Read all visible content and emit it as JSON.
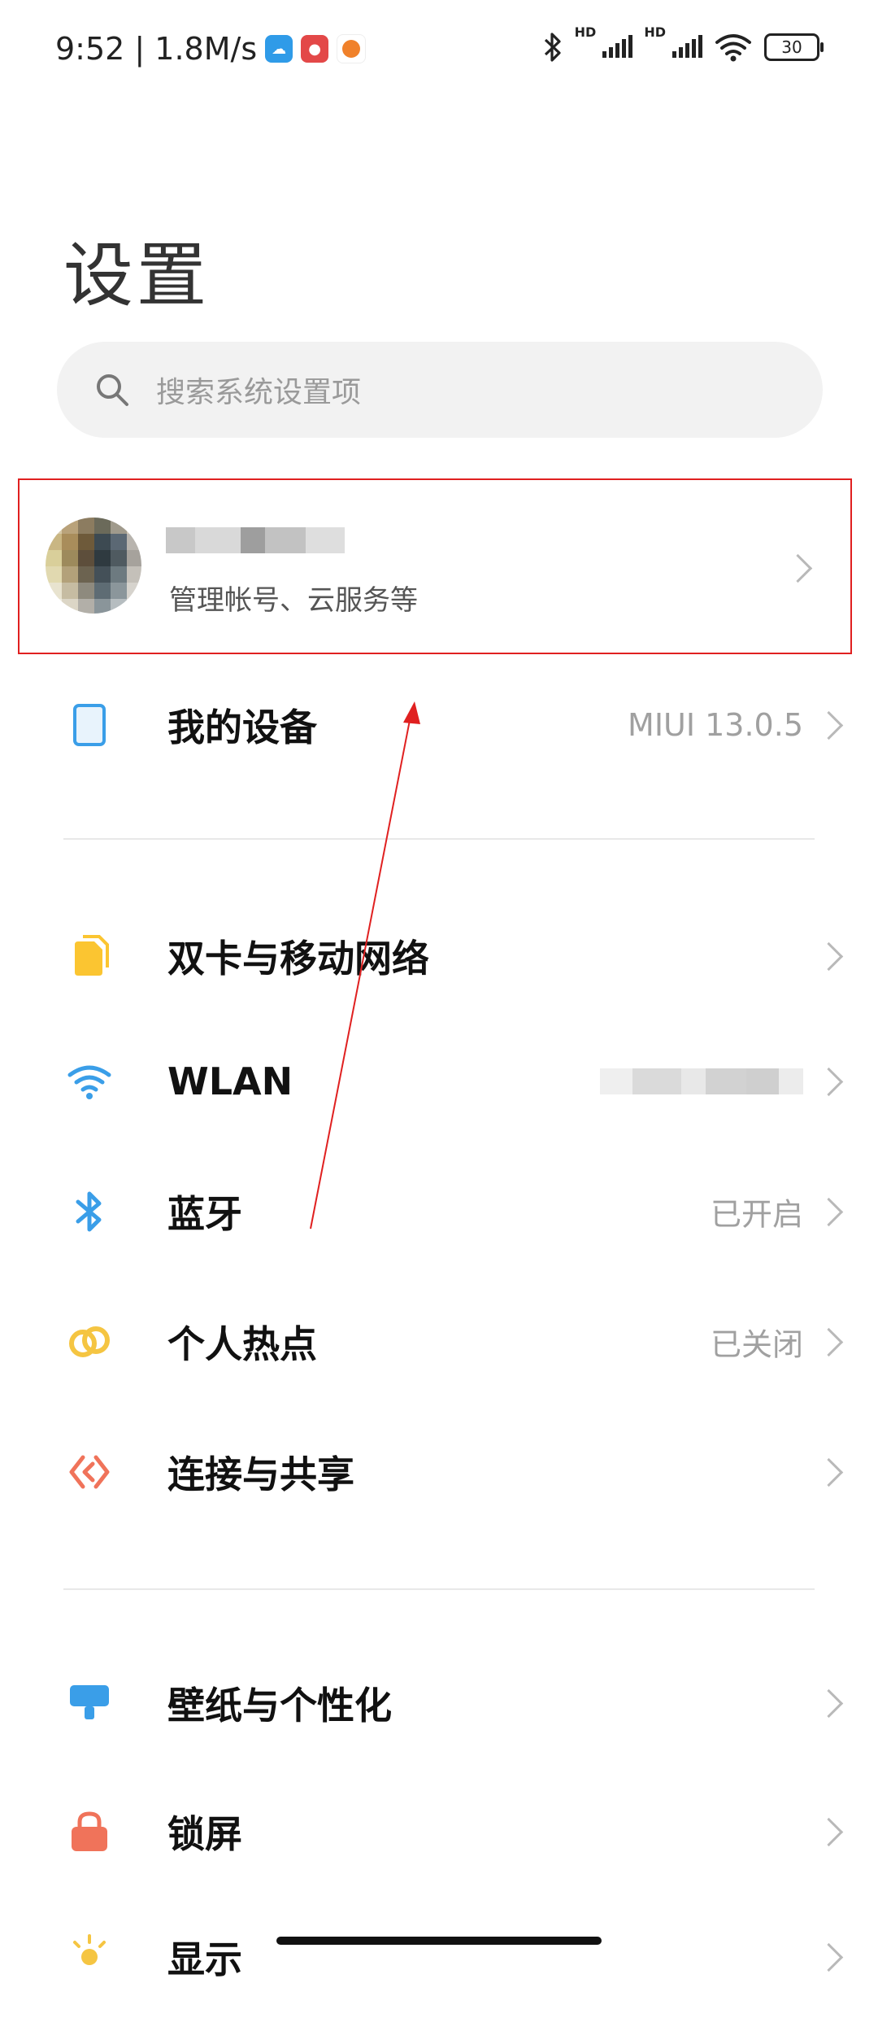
{
  "status_bar": {
    "time_speed": "9:52 | 1.8M/s",
    "battery": "30",
    "hd": "HD"
  },
  "page": {
    "title": "设置"
  },
  "search": {
    "placeholder": "搜索系统设置项"
  },
  "account": {
    "subtitle": "管理帐号、云服务等"
  },
  "rows": [
    {
      "label": "我的设备",
      "value": "MIUI 13.0.5",
      "icon": "device-icon",
      "color": "#3a9ee8"
    },
    {
      "label": "双卡与移动网络",
      "value": "",
      "icon": "sim-card-icon",
      "color": "#fbc531"
    },
    {
      "label": "WLAN",
      "value": "",
      "icon": "wifi-icon",
      "color": "#3a9ee8"
    },
    {
      "label": "蓝牙",
      "value": "已开启",
      "icon": "bluetooth-icon",
      "color": "#3a9ee8"
    },
    {
      "label": "个人热点",
      "value": "已关闭",
      "icon": "hotspot-icon",
      "color": "#f5c542"
    },
    {
      "label": "连接与共享",
      "value": "",
      "icon": "share-icon",
      "color": "#f0735a"
    },
    {
      "label": "壁纸与个性化",
      "value": "",
      "icon": "wallpaper-icon",
      "color": "#3a9ee8"
    },
    {
      "label": "锁屏",
      "value": "",
      "icon": "lock-icon",
      "color": "#f0735a"
    },
    {
      "label": "显示",
      "value": "",
      "icon": "display-icon",
      "color": "#f5c542"
    }
  ],
  "colors": {
    "annotation": "#e02020"
  }
}
